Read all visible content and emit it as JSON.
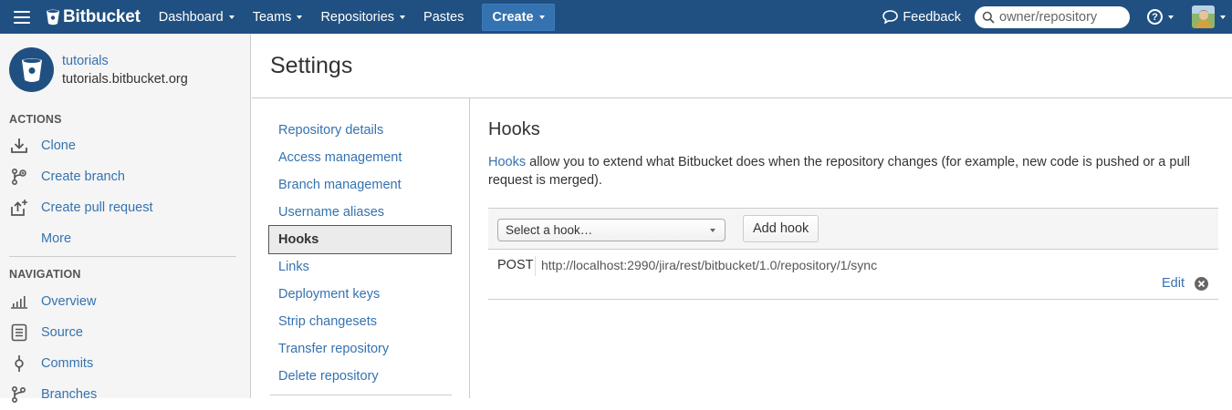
{
  "topbar": {
    "brand": "Bitbucket",
    "nav": [
      {
        "label": "Dashboard",
        "has_caret": true
      },
      {
        "label": "Teams",
        "has_caret": true
      },
      {
        "label": "Repositories",
        "has_caret": true
      },
      {
        "label": "Pastes",
        "has_caret": false
      }
    ],
    "create_label": "Create",
    "feedback_label": "Feedback",
    "search_placeholder": "owner/repository",
    "help_icon": "question-circle-icon",
    "colors": {
      "bar": "#205081",
      "create": "#3572b0"
    }
  },
  "sidebar": {
    "repo_owner": "tutorials",
    "repo_site": "tutorials.bitbucket.org",
    "actions_title": "ACTIONS",
    "actions": [
      {
        "label": "Clone",
        "icon": "download-icon"
      },
      {
        "label": "Create branch",
        "icon": "branch-icon"
      },
      {
        "label": "Create pull request",
        "icon": "pull-request-icon"
      },
      {
        "label": "More",
        "icon": ""
      }
    ],
    "navigation_title": "NAVIGATION",
    "navigation": [
      {
        "label": "Overview",
        "icon": "bar-chart-icon"
      },
      {
        "label": "Source",
        "icon": "document-icon"
      },
      {
        "label": "Commits",
        "icon": "commit-icon"
      },
      {
        "label": "Branches",
        "icon": "branch-icon"
      }
    ]
  },
  "main": {
    "page_title": "Settings",
    "settings_nav": [
      "Repository details",
      "Access management",
      "Branch management",
      "Username aliases",
      "Hooks",
      "Links",
      "Deployment keys",
      "Strip changesets",
      "Transfer repository",
      "Delete repository"
    ],
    "active_item": "Hooks",
    "hooks": {
      "title": "Hooks",
      "desc_link": "Hooks",
      "desc_text": " allow you to extend what Bitbucket does when the repository changes (for example, new code is pushed or a pull request is merged).",
      "select_value": "Select a hook…",
      "add_label": "Add hook",
      "rows": [
        {
          "method": "POST",
          "url": "http://localhost:2990/jira/rest/bitbucket/1.0/repository/1/sync",
          "edit_label": "Edit"
        }
      ]
    }
  }
}
